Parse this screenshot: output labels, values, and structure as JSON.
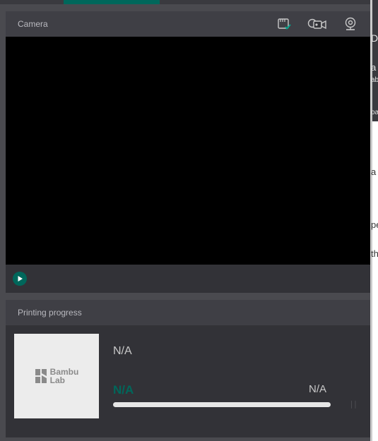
{
  "camera": {
    "title": "Camera",
    "icons": [
      "sd-card-icon",
      "camera-record-icon",
      "webcam-icon"
    ]
  },
  "progress": {
    "title": "Printing progress",
    "thumbnail_logo": {
      "line1": "Bambu",
      "line2": "Lab"
    },
    "task_name": "N/A",
    "percent": "N/A",
    "remaining": "N/A",
    "fraction": 0,
    "accent_color": "#00675b"
  },
  "right_panel_fragments": [
    "D",
    "a",
    "ab",
    "oa",
    "a",
    "pe",
    "th"
  ]
}
